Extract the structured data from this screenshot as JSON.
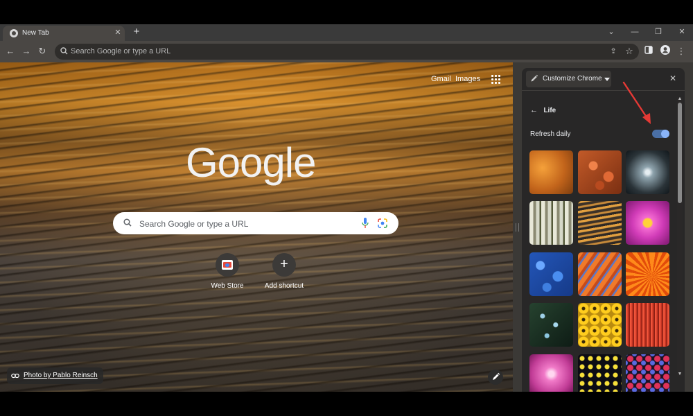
{
  "browser": {
    "tab": {
      "title": "New Tab"
    },
    "omnibox": {
      "placeholder": "Search Google or type a URL"
    }
  },
  "ntp": {
    "top_links": {
      "gmail": "Gmail",
      "images": "Images"
    },
    "logo_text": "Google",
    "search": {
      "placeholder": "Search Google or type a URL"
    },
    "shortcuts": [
      {
        "label": "Web Store"
      },
      {
        "label": "Add shortcut"
      }
    ],
    "photo_credit": "Photo by Pablo Reinsch"
  },
  "side_panel": {
    "title": "Customize Chrome",
    "collection": "Life",
    "refresh_label": "Refresh daily",
    "refresh_daily_on": true,
    "accent_color": "#8ab4f8",
    "annotation_arrow_color": "#e53935"
  }
}
